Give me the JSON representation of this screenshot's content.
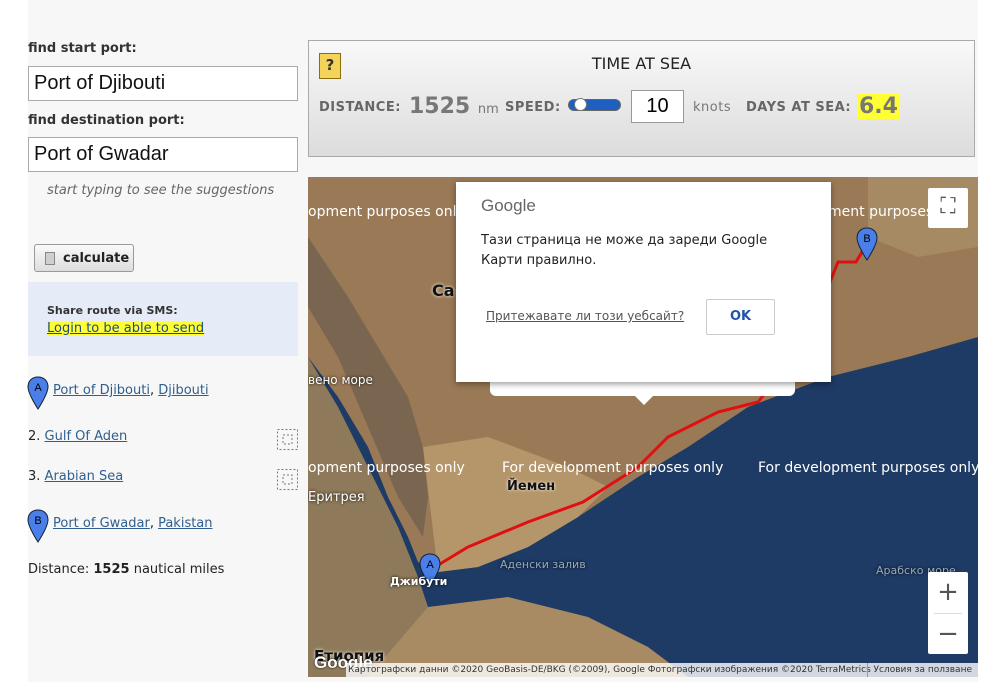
{
  "form": {
    "start_label": "find start port:",
    "start_value": "Port of Djibouti",
    "dest_label": "find destination port:",
    "dest_value": "Port of Gwadar",
    "hint": "start typing to see the suggestions",
    "calculate_label": "calculate"
  },
  "sms": {
    "title": "Share route via SMS:",
    "link": "Login to be able to send"
  },
  "route": {
    "start": {
      "marker": "A",
      "port": "Port of Djibouti",
      "country": "Djibouti"
    },
    "waypoints": [
      {
        "num": "2.",
        "name": "Gulf Of Aden"
      },
      {
        "num": "3.",
        "name": "Arabian Sea"
      }
    ],
    "end": {
      "marker": "B",
      "port": "Port of Gwadar",
      "country": "Pakistan"
    },
    "distance_prefix": "Distance:",
    "distance_value": "1525",
    "distance_suffix": "nautical miles"
  },
  "calculator": {
    "help_icon": "?",
    "title": "TIME AT SEA",
    "distance_label": "DISTANCE:",
    "distance_value": "1525",
    "distance_unit": "nm",
    "speed_label": "SPEED:",
    "speed_value": "10",
    "speed_unit": "knots",
    "days_label": "DAYS AT SEA:",
    "days_value": "6.4"
  },
  "map": {
    "dev_text": "For development purposes only",
    "dev_text_partial": "opment purposes only",
    "dev_text_partial2": "ment purposes only",
    "labels": {
      "yemen": "Йемен",
      "eritrea": "Еритрея",
      "djibouti": "Джибути",
      "ethiopia": "Етиопия",
      "gulf": "Аденски залив",
      "arabian_sea": "Арабско море",
      "red_sea_partial": "вено море",
      "saudi_partial": "Са"
    },
    "marker_a": "A",
    "marker_b": "B",
    "google_logo": "Google",
    "attribution": "Картографски данни ©2020 GeoBasis-DE/BKG (©2009), Google Фотографски изображения ©2020 TerraMetrics",
    "terms": "Условия за ползване",
    "zoom_in": "+",
    "zoom_out": "−",
    "fullscreen_icon": "fullscreen-icon",
    "route_color": "#e01010"
  },
  "dialog": {
    "logo": "Google",
    "message": "Тази страница не може да зареди Google Карти правилно.",
    "own_site": "Притежавате ли този уебсайт?",
    "ok": "OK"
  }
}
